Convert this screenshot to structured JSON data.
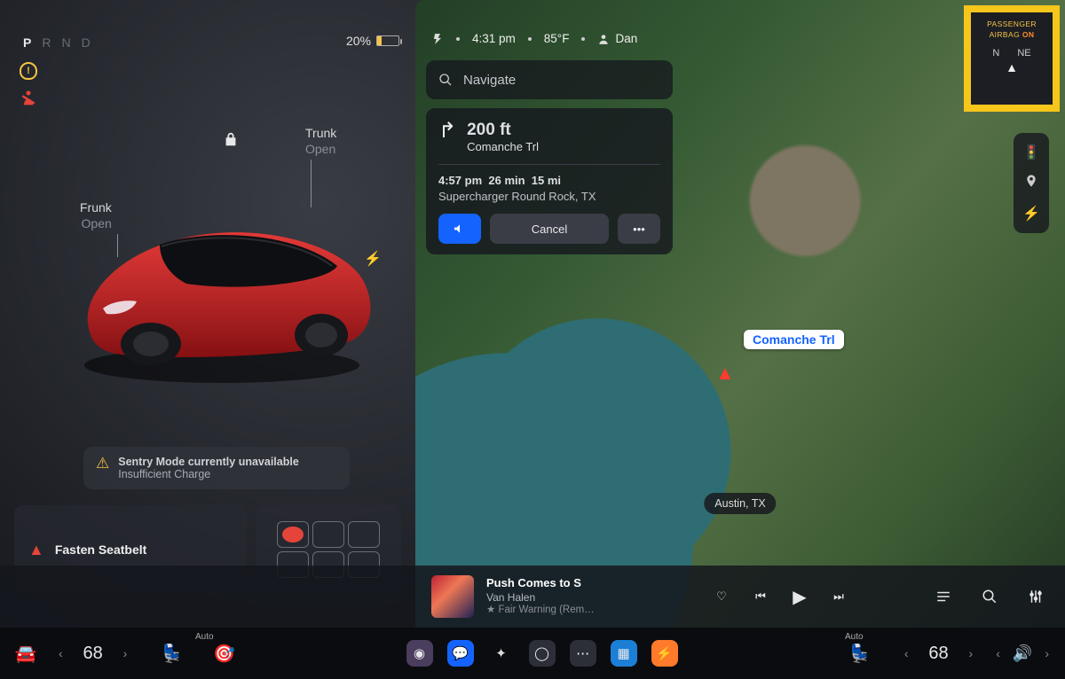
{
  "gear": {
    "p": "P",
    "r": "R",
    "n": "N",
    "d": "D",
    "active": "P"
  },
  "battery": {
    "percent": "20%",
    "level": 0.2
  },
  "warnings": {
    "tpms": "tire-pressure",
    "seatbelt": "seatbelt"
  },
  "car": {
    "frunk_label": "Frunk",
    "frunk_action": "Open",
    "trunk_label": "Trunk",
    "trunk_action": "Open",
    "locked": true,
    "charge_port_icon": "bolt"
  },
  "sentry": {
    "title": "Sentry Mode currently unavailable",
    "sub": "Insufficient Charge"
  },
  "seatbelt_alert": "Fasten Seatbelt",
  "status": {
    "time": "4:31 pm",
    "temp": "85°F",
    "profile": "Dan"
  },
  "search": {
    "placeholder": "Navigate"
  },
  "turn": {
    "distance": "200 ft",
    "street": "Comanche Trl"
  },
  "eta": {
    "arrive": "4:57 pm",
    "duration": "26 min",
    "distance": "15 mi"
  },
  "destination": "Supercharger Round Rock, TX",
  "buttons": {
    "cancel": "Cancel"
  },
  "street_tag": "Comanche Trl",
  "city_tag": "Austin, TX",
  "airbag": {
    "label": "PASSENGER",
    "label2": "AIRBAG",
    "state": "ON",
    "compass_n": "N",
    "compass_ne": "NE"
  },
  "media": {
    "title": "Push Comes to S",
    "artist": "Van Halen",
    "album": "Fair Warning (Rem…"
  },
  "climate": {
    "left_temp": "68",
    "right_temp": "68",
    "auto": "Auto"
  }
}
